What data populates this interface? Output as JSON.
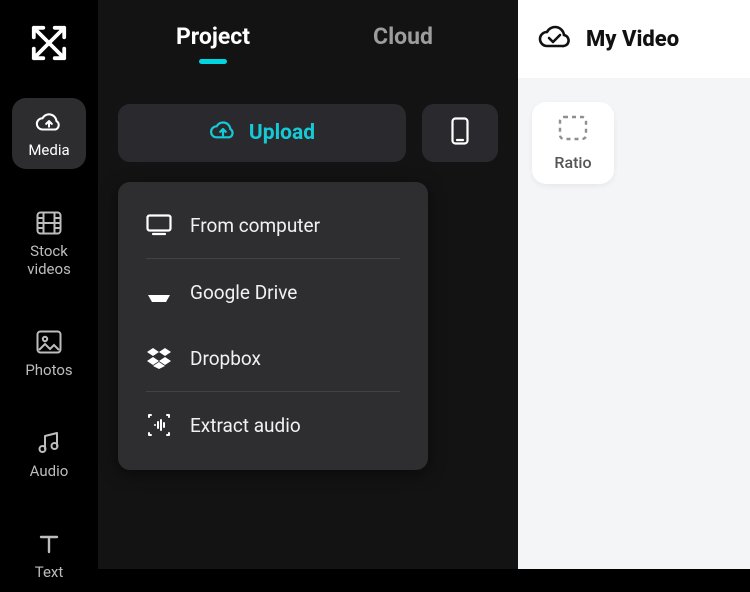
{
  "sidebar": {
    "items": [
      {
        "label": "Media"
      },
      {
        "label": "Stock\nvideos"
      },
      {
        "label": "Photos"
      },
      {
        "label": "Audio"
      },
      {
        "label": "Text"
      }
    ]
  },
  "tabs": {
    "project": "Project",
    "cloud": "Cloud"
  },
  "actions": {
    "upload_label": "Upload"
  },
  "upload_menu": {
    "from_computer": "From computer",
    "google_drive": "Google Drive",
    "dropbox": "Dropbox",
    "extract_audio": "Extract audio"
  },
  "right": {
    "title": "My Video",
    "ratio_label": "Ratio"
  }
}
